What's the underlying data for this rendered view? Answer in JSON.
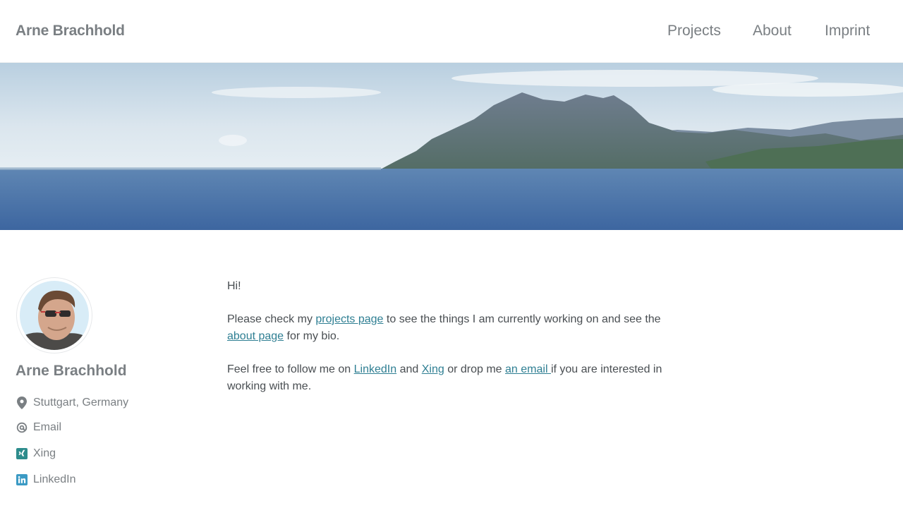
{
  "site": {
    "title": "Arne Brachhold"
  },
  "nav": {
    "items": [
      "Projects",
      "About",
      "Imprint"
    ]
  },
  "colors": {
    "link": "#2f7f93",
    "muted": "#7a7f83",
    "text": "#494e52",
    "xing": "#2d8c8c",
    "linkedin": "#3b9ac4"
  },
  "sidebar": {
    "name": "Arne Brachhold",
    "location": "Stuttgart, Germany",
    "links": [
      {
        "icon": "at-icon",
        "label": "Email"
      },
      {
        "icon": "xing-icon",
        "label": "Xing"
      },
      {
        "icon": "linkedin-icon",
        "label": "LinkedIn"
      }
    ]
  },
  "content": {
    "greeting": "Hi!",
    "p1": {
      "t1": "Please check my ",
      "projects_link": "projects page",
      "t2": " to see the things I am currently working on and see the ",
      "about_link": "about page",
      "t3": " for my bio."
    },
    "p2": {
      "t1": "Feel free to follow me on ",
      "linkedin_link": "LinkedIn",
      "t2": " and ",
      "xing_link": "Xing",
      "t3": " or drop me ",
      "email_link": "an email ",
      "t4": "if you are interested in working with me."
    }
  }
}
